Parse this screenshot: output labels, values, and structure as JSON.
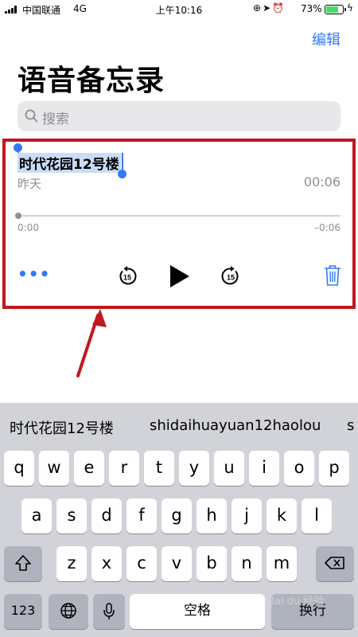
{
  "status_bar": {
    "carrier": "中国联通",
    "network": "4G",
    "time": "上午10:16",
    "battery": "73%",
    "battery_level": 0.73,
    "icons": [
      "rotation-lock-icon",
      "location-icon",
      "alarm-icon",
      "battery-icon",
      "charging-icon"
    ]
  },
  "nav": {
    "edit_label": "编辑"
  },
  "page": {
    "title": "语音备忘录"
  },
  "search": {
    "placeholder": "搜索"
  },
  "recording": {
    "title": "时代花园12号楼",
    "date": "昨天",
    "duration": "00:06",
    "elapsed": "0:00",
    "remaining": "–0:06",
    "progress": 0,
    "skip_back_label": "15",
    "skip_forward_label": "15",
    "more_label": "•••"
  },
  "keyboard": {
    "suggestions": [
      "时代花园12号楼",
      "shidaihuayuan12haolou",
      "s"
    ],
    "row1": [
      "q",
      "w",
      "e",
      "r",
      "t",
      "y",
      "u",
      "i",
      "o",
      "p"
    ],
    "row2": [
      "a",
      "s",
      "d",
      "f",
      "g",
      "h",
      "j",
      "k",
      "l"
    ],
    "row3": [
      "z",
      "x",
      "c",
      "v",
      "b",
      "n",
      "m"
    ],
    "numbers_label": "123",
    "space_label": "空格",
    "return_label": "换行"
  },
  "watermark": "Bai du 经验",
  "colors": {
    "accent": "#3478f6",
    "highlight_border": "#c0181f",
    "selection": "#c9dcf7",
    "keyboard_bg": "#d1d3d9"
  }
}
